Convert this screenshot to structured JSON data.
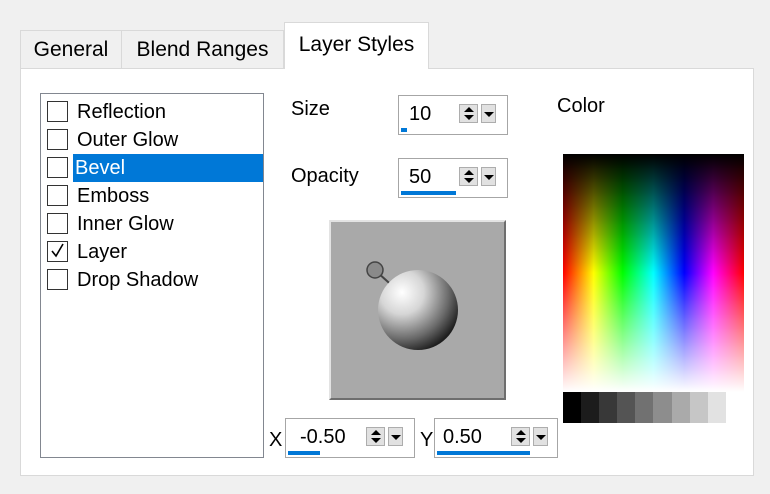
{
  "tabs": [
    {
      "label": "General",
      "active": false
    },
    {
      "label": "Blend Ranges",
      "active": false
    },
    {
      "label": "Layer Styles",
      "active": true
    }
  ],
  "styles_list": [
    {
      "label": "Reflection",
      "checked": false,
      "selected": false
    },
    {
      "label": "Outer Glow",
      "checked": false,
      "selected": false
    },
    {
      "label": "Bevel",
      "checked": false,
      "selected": true
    },
    {
      "label": "Emboss",
      "checked": false,
      "selected": false
    },
    {
      "label": "Inner Glow",
      "checked": false,
      "selected": false
    },
    {
      "label": "Layer",
      "checked": true,
      "selected": false
    },
    {
      "label": "Drop Shadow",
      "checked": false,
      "selected": false
    }
  ],
  "size": {
    "label": "Size",
    "value": "10",
    "level_fraction": 0.1
  },
  "opacity": {
    "label": "Opacity",
    "value": "50",
    "level_fraction": 0.5
  },
  "light_x": {
    "label": "X",
    "value": "-0.50",
    "level_fraction": 0.25
  },
  "light_y": {
    "label": "Y",
    "value": "0.50",
    "level_fraction": 0.75
  },
  "color": {
    "label": "Color"
  },
  "colors": {
    "selection": "#0078d7",
    "progress": "#0078d7",
    "preview_bg": "#a9a9a9"
  }
}
